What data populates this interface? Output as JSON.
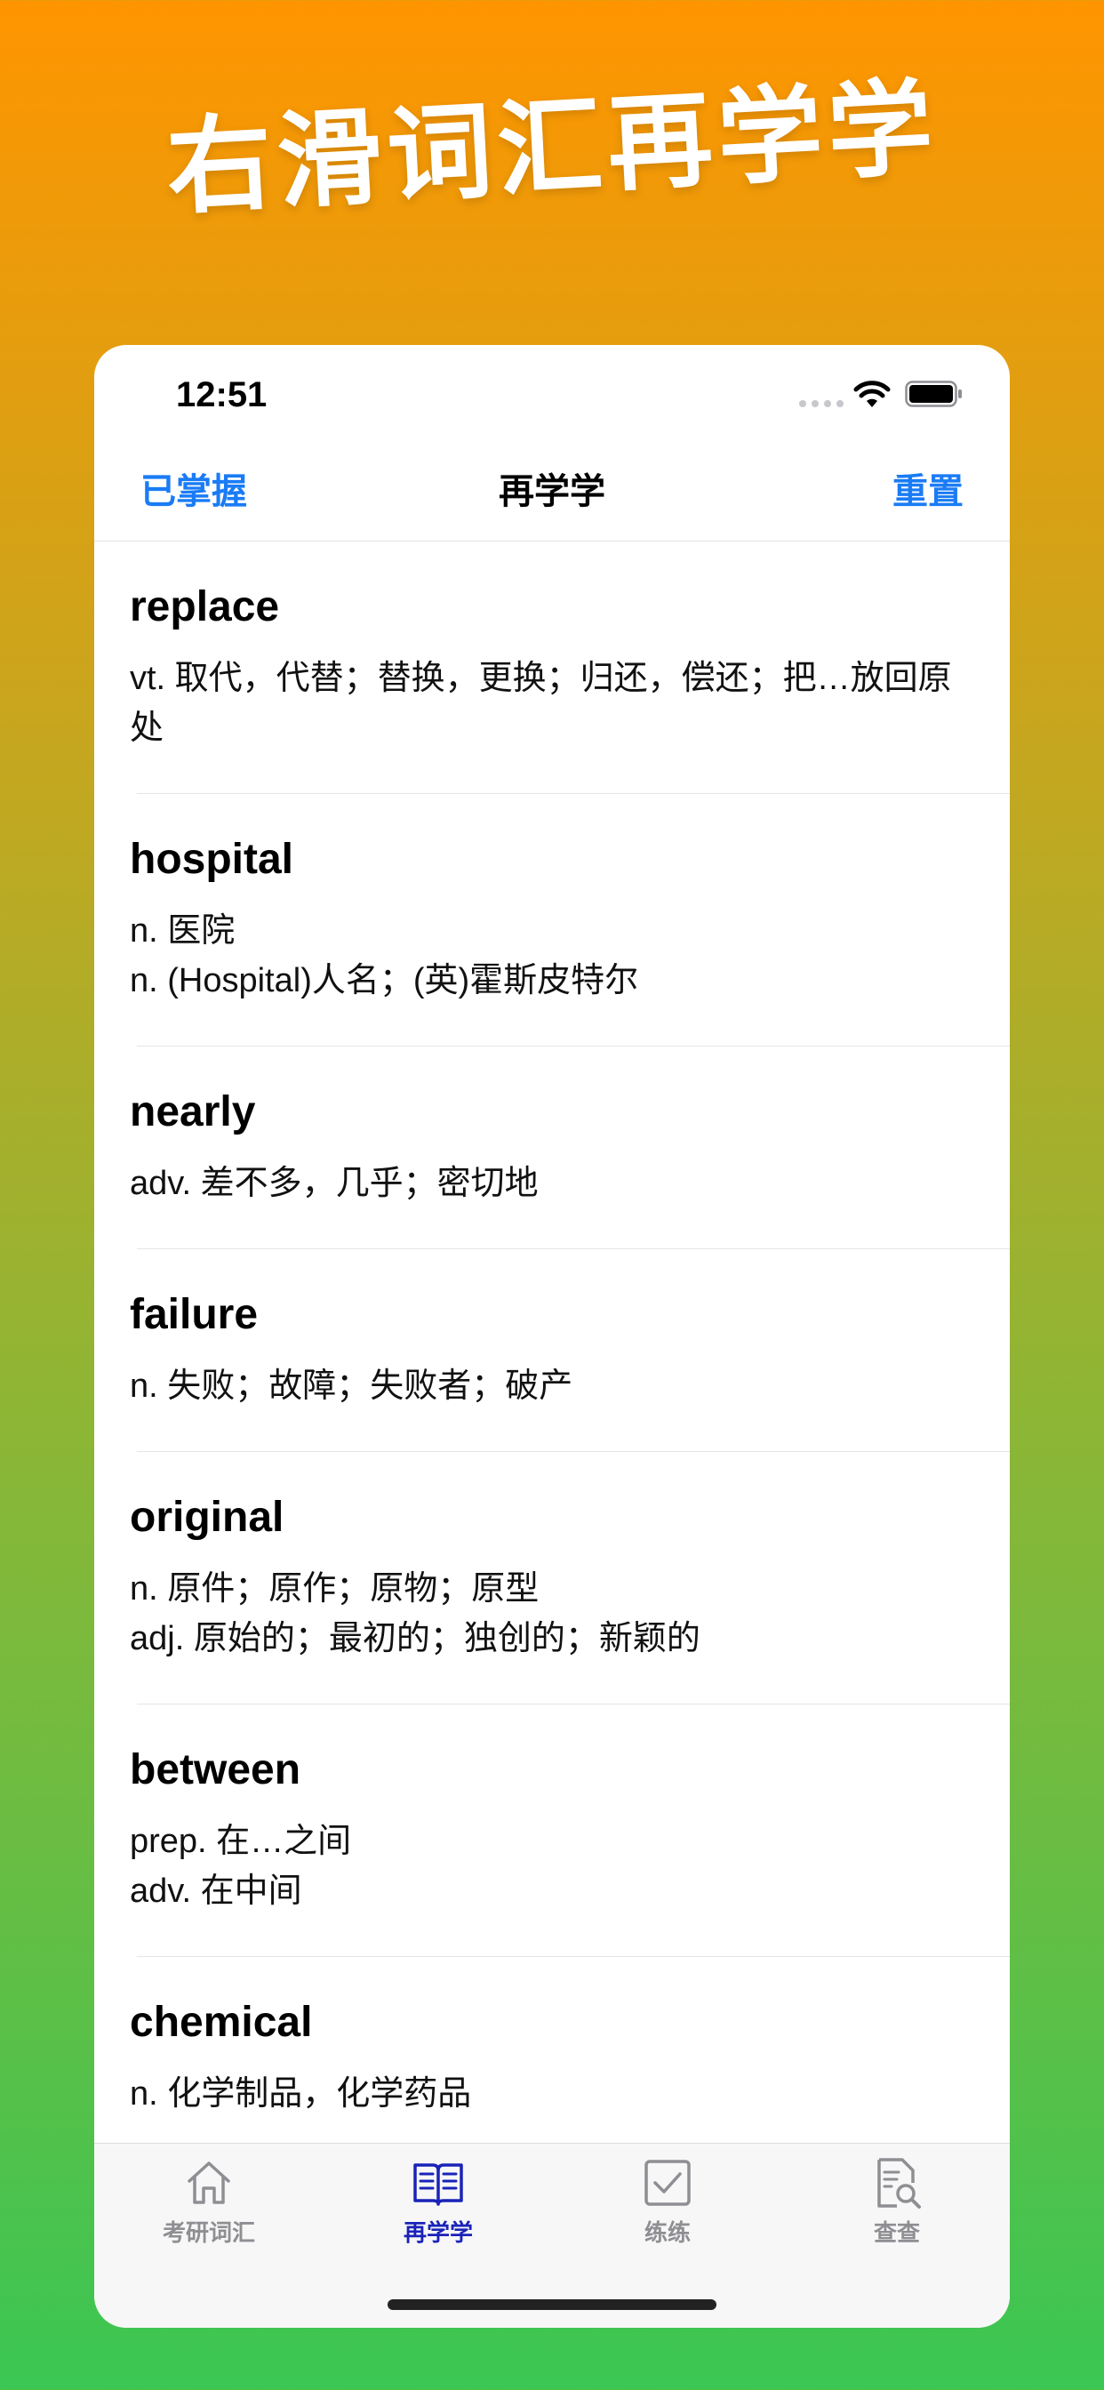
{
  "headline": "右滑词汇再学学",
  "status": {
    "time": "12:51"
  },
  "nav": {
    "left": "已掌握",
    "title": "再学学",
    "right": "重置"
  },
  "words": [
    {
      "word": "replace",
      "definition": "vt. 取代，代替；替换，更换；归还，偿还；把…放回原处"
    },
    {
      "word": "hospital",
      "definition": "n. 医院\nn. (Hospital)人名；(英)霍斯皮特尔"
    },
    {
      "word": "nearly",
      "definition": "adv. 差不多，几乎；密切地"
    },
    {
      "word": "failure",
      "definition": "n. 失败；故障；失败者；破产"
    },
    {
      "word": "original",
      "definition": "n. 原件；原作；原物；原型\nadj. 原始的；最初的；独创的；新颖的"
    },
    {
      "word": "between",
      "definition": "prep. 在…之间\nadv. 在中间"
    },
    {
      "word": "chemical",
      "definition": "n. 化学制品，化学药品"
    }
  ],
  "tabs": [
    {
      "label": "考研词汇",
      "icon": "home-icon"
    },
    {
      "label": "再学学",
      "icon": "book-icon"
    },
    {
      "label": "练练",
      "icon": "checkbox-icon"
    },
    {
      "label": "查查",
      "icon": "document-search-icon"
    }
  ],
  "colors": {
    "accent": "#1a7cf5",
    "active_tab": "#1a23b8",
    "inactive_tab": "#8e8e93"
  }
}
